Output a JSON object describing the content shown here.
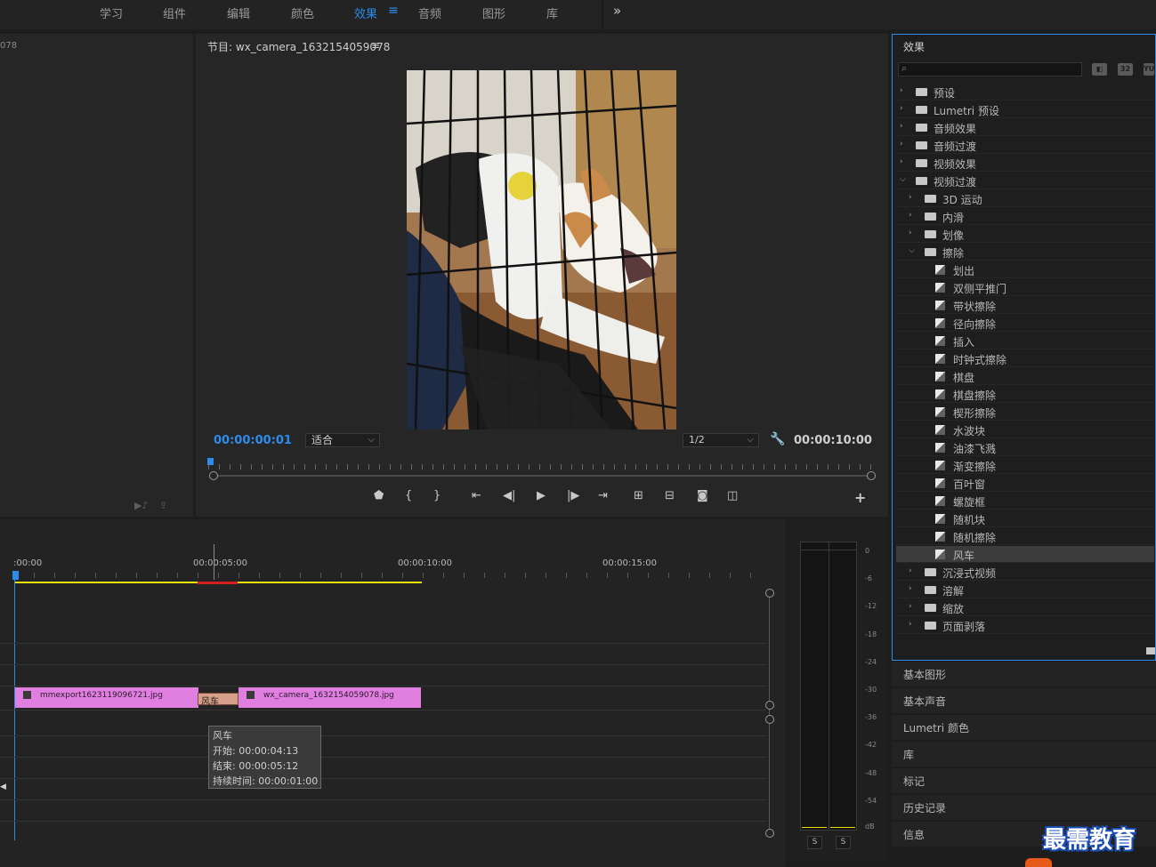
{
  "workspace": {
    "tabs": [
      "学习",
      "组件",
      "编辑",
      "颜色",
      "效果",
      "音频",
      "图形",
      "库"
    ],
    "active": "效果",
    "menu_glyph": "≡",
    "more_glyph": "»"
  },
  "source": {
    "label": "078"
  },
  "program": {
    "title": "节目: wx_camera_1632154059078",
    "menu_glyph": "≡",
    "timecode_current": "00:00:00:01",
    "fit": "适合",
    "resolution": "1/2",
    "timecode_duration": "00:00:10:00"
  },
  "timeline": {
    "ruler_labels": [
      ":00:00",
      "00:00:05:00",
      "00:00:10:00",
      "00:00:15:00"
    ],
    "clip1": "mmexport1623119096721.jpg",
    "clip2": "wx_camera_1632154059078.jpg",
    "transition": "风车",
    "tooltip": {
      "name": "风车",
      "start": "开始: 00:00:04:13",
      "end": "结束: 00:00:05:12",
      "duration": "持续时间: 00:00:01:00"
    }
  },
  "meters": {
    "db_labels": [
      "0",
      "-6",
      "-12",
      "-18",
      "-24",
      "-30",
      "-36",
      "-42",
      "-48",
      "-54",
      "dB"
    ],
    "solo": [
      "S",
      "S"
    ]
  },
  "effects": {
    "title": "效果",
    "buttons": [
      "◧",
      "32",
      "YUV"
    ],
    "items": [
      {
        "label": "预设",
        "kind": "preset",
        "level": 0,
        "open": false
      },
      {
        "label": "Lumetri 预设",
        "kind": "preset",
        "level": 0,
        "open": false
      },
      {
        "label": "音频效果",
        "kind": "folder",
        "level": 0,
        "open": false
      },
      {
        "label": "音频过渡",
        "kind": "folder",
        "level": 0,
        "open": false
      },
      {
        "label": "视频效果",
        "kind": "folder",
        "level": 0,
        "open": false
      },
      {
        "label": "视频过渡",
        "kind": "folder",
        "level": 0,
        "open": true
      },
      {
        "label": "3D 运动",
        "kind": "folder",
        "level": 1,
        "open": false
      },
      {
        "label": "内滑",
        "kind": "folder",
        "level": 1,
        "open": false
      },
      {
        "label": "划像",
        "kind": "folder",
        "level": 1,
        "open": false
      },
      {
        "label": "擦除",
        "kind": "folder",
        "level": 1,
        "open": true
      },
      {
        "label": "划出",
        "kind": "effect",
        "level": 2
      },
      {
        "label": "双侧平推门",
        "kind": "effect",
        "level": 2
      },
      {
        "label": "带状擦除",
        "kind": "effect",
        "level": 2
      },
      {
        "label": "径向擦除",
        "kind": "effect",
        "level": 2
      },
      {
        "label": "插入",
        "kind": "effect",
        "level": 2
      },
      {
        "label": "时钟式擦除",
        "kind": "effect",
        "level": 2
      },
      {
        "label": "棋盘",
        "kind": "effect",
        "level": 2
      },
      {
        "label": "棋盘擦除",
        "kind": "effect",
        "level": 2
      },
      {
        "label": "楔形擦除",
        "kind": "effect",
        "level": 2
      },
      {
        "label": "水波块",
        "kind": "effect",
        "level": 2
      },
      {
        "label": "油漆飞溅",
        "kind": "effect",
        "level": 2
      },
      {
        "label": "渐变擦除",
        "kind": "effect",
        "level": 2
      },
      {
        "label": "百叶窗",
        "kind": "effect",
        "level": 2
      },
      {
        "label": "螺旋框",
        "kind": "effect",
        "level": 2
      },
      {
        "label": "随机块",
        "kind": "effect",
        "level": 2
      },
      {
        "label": "随机擦除",
        "kind": "effect",
        "level": 2
      },
      {
        "label": "风车",
        "kind": "effect",
        "level": 2,
        "selected": true
      },
      {
        "label": "沉浸式视频",
        "kind": "folder",
        "level": 1,
        "open": false
      },
      {
        "label": "溶解",
        "kind": "folder",
        "level": 1,
        "open": false
      },
      {
        "label": "缩放",
        "kind": "folder",
        "level": 1,
        "open": false
      },
      {
        "label": "页面剥落",
        "kind": "folder",
        "level": 1,
        "open": false
      }
    ]
  },
  "side_panels": [
    "基本图形",
    "基本声音",
    "Lumetri 颜色",
    "库",
    "标记",
    "历史记录",
    "信息"
  ],
  "watermark": "最需教育"
}
